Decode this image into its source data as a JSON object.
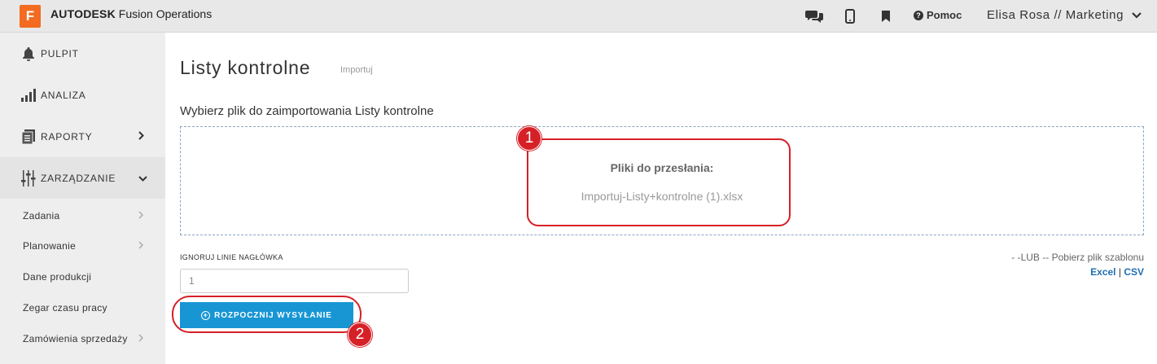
{
  "app": {
    "logo_letter": "F",
    "brand_bold": "AUTODESK",
    "brand_rest": "Fusion Operations"
  },
  "header": {
    "help_label": "Pomoc",
    "user_label": "Elisa Rosa // Marketing"
  },
  "sidebar": {
    "items": [
      {
        "label": "PULPIT"
      },
      {
        "label": "ANALIZA"
      },
      {
        "label": "RAPORTY"
      },
      {
        "label": "ZARZĄDZANIE"
      }
    ],
    "sub_items": [
      {
        "label": "Zadania"
      },
      {
        "label": "Planowanie"
      },
      {
        "label": "Dane produkcji"
      },
      {
        "label": "Zegar czasu pracy"
      },
      {
        "label": "Zamówienia sprzedaży"
      }
    ]
  },
  "main": {
    "title": "Listy kontrolne",
    "subtitle": "Importuj",
    "section_label": "Wybierz plik do zaimportowania Listy kontrolne",
    "dropzone": {
      "title": "Pliki do przesłania:",
      "file_name": "Importuj-Listy+kontrolne (1).xlsx"
    },
    "ignore_label": "IGNORUJ LINIE NAGŁÓWKA",
    "ignore_value": "1",
    "template_label": "- -LUB -- Pobierz plik szablonu",
    "excel_link": "Excel",
    "separator": "|",
    "csv_link": "CSV",
    "start_button": "ROZPOCZNIJ WYSYŁANIE",
    "annotations": [
      "1",
      "2"
    ]
  },
  "colors": {
    "accent": "#1896d4",
    "annotation": "#d62027",
    "logo": "#f26b21"
  }
}
